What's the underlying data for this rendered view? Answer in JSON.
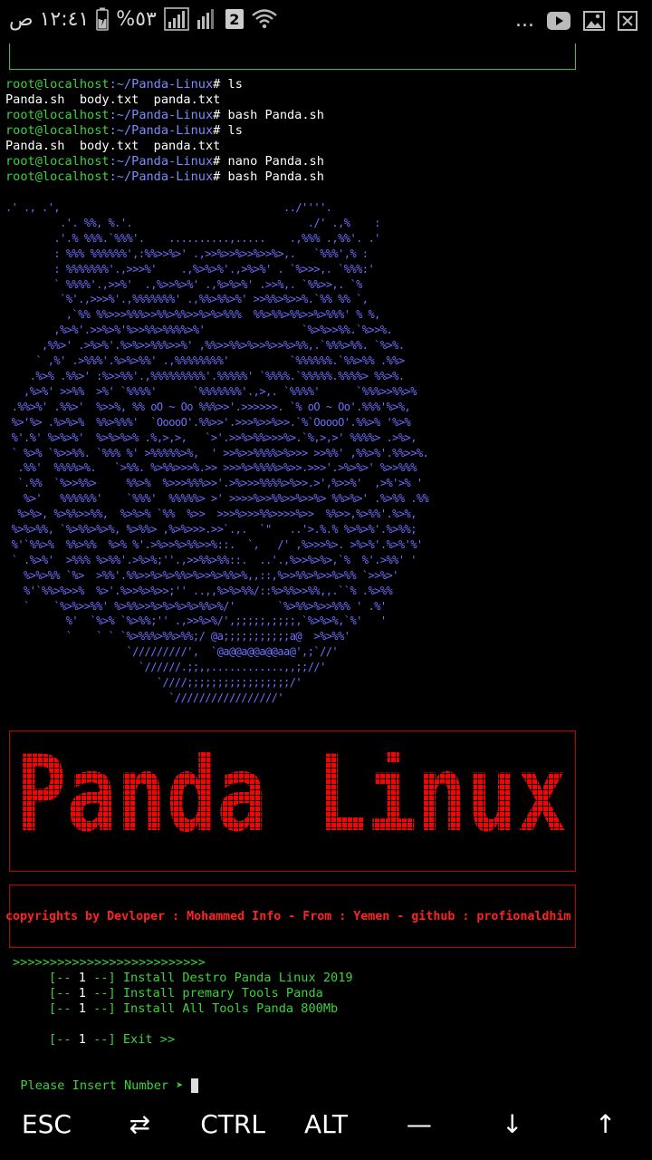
{
  "status_bar": {
    "time": "١٢:٤١ ص",
    "battery": "%٥٣",
    "sim": "2",
    "more": "...",
    "icons": [
      "battery-icon",
      "signal-icon",
      "sim-icon",
      "wifi-icon",
      "youtube-icon",
      "gallery-icon",
      "close-box-icon"
    ]
  },
  "terminal": {
    "history": [
      {
        "user": "root@localhost",
        "path": ":~/Panda-Linux",
        "prompt": "#",
        "cmd": " ls"
      },
      {
        "output": "Panda.sh  body.txt  panda.txt"
      },
      {
        "user": "root@localhost",
        "path": ":~/Panda-Linux",
        "prompt": "#",
        "cmd": " bash Panda.sh"
      },
      {
        "user": "root@localhost",
        "path": ":~/Panda-Linux",
        "prompt": "#",
        "cmd": " ls"
      },
      {
        "output": "Panda.sh  body.txt  panda.txt"
      },
      {
        "user": "root@localhost",
        "path": ":~/Panda-Linux",
        "prompt": "#",
        "cmd": " nano Panda.sh"
      },
      {
        "user": "root@localhost",
        "path": ":~/Panda-Linux",
        "prompt": "#",
        "cmd": " bash Panda.sh"
      }
    ],
    "ascii_art": [
      ".' ., .',                                     ../''''.",
      "         .'. %%, %.'.                             ./' .,%    :",
      "        .'.% %%%.`%%%'.    ..........,.....    .,%%% .,%%'. .'",
      "        : %%% %%%%%%',:%%>>%>' .,>>%>>%>>%>>%>,.   `%%%',% :",
      "        : %%%%%%%'.,>>>%'    .,%>%>%'.,>%>%' . `%>>>,. `%%%:'",
      "        ` %%%%'.,>>%'  .,%>>%>%' .,%>%>%' .>>%,. `%%>>,. `%",
      "         `%'.,>>>%'.,%%%%%%%' .,%%>%%>%' >>%%>%>>%.`%% %% `,",
      "          ,`%% %%>>>%%%>>%%>%%>>%>%>%%%  %%>%%>%%>>%>%%%' % %,",
      "        ,%>%'.>>%>%'%>>%%>%%%%>%'                `%>%>>%%.`%>>%.",
      "      ,%%>' .>%>%'.%>%>>%%%>>%' ,%%>>%%>%>>%>>%>%%,.`%%%>%%. `%>%.",
      "     ` ,%' .>%%%'.%>%>%%' .,%%%%%%%%'          `%%%%%%.`%%>%% .%%>",
      "    .%>% .%%>' :%>>%%'.,%%%%%%%%%'.%%%%%' `%%%%.`%%%%%.%%%%> %%>%.",
      "   ,%>%' >>%%  >%' `%%%%'      `%%%%%%%'.,>,. `%%%%'      `%%%>>%%>%",
      " .%%>%' .%%>'  %>>%, %% oO ~ Oo %%%>>'.>>>>>>. `% oO ~ Oo'.%%%'%>%,",
      " %>'%> .%>%>%  %%>%%%'  `OoooO'.%%>>'.>>>%>>%>>.`%`OoooO'.%%>% '%>%",
      " %'.%' %>%>%'  %>%>%>% .%,>,>,   `>'.>>%>%%>>>%>.`%,>,>' %%%%> .>%>,",
      " ` %>% `%>>%%. `%%% %' >%%%%%>%,  ' >>%>>%%%%>%>>> >>%%' ,%%>%'.%%>>%.",
      "  .%%'  %%%%>%.   `>%%. %>%%>>>%.>> >>>%>%%%%>%>>.>>>'.>%>%>' %>>%%%",
      "  `.%%  `%>>%%>     %%>%  %>>>%%%>>'.>%>>>%%%%>%>>.>',%>>%'  ,>%'>% '",
      "   %>'   %%%%%%'    `%%%'  %%%%%> >' >>>>%>>%%>>%>>%> %%>%>' .%>%% .%%",
      "  %>%>, %>%%>>%%,  %>%>% `%%  %>>  >>>%>>>%%>>>>%>>  %%>>,%>%%'.%>%,",
      " %>%>%%, `%>%%>%>%, %>%%> ,%>%>>>.>>`.,.  `\"   ..'>.%.% %>%>%'.%>%%;",
      " %'`%%>%  %%>%%  %>% %'.>%>>%>%%>>%::.  `,   /' ,%>>>%>. >%>%'.%>%'%'",
      " ` .%>%'  >%%% %>%%'.>%>%;''.,>>%%>%%::.  ..'.,%>>%>%>,`%  %'.>%%' '",
      "   %>%>%% `%>  >%%'.%%>>%>%>%%>%>>%>%%>%,,::,%>>%%>%>>%>%% `>>%>'",
      "   %'`%%>%>>%  %>'.%>>%>%>>;'' ..,,%>%>%%/::%>%%>>%%,,.``% .%>%%",
      "   `    `%>%>>%%' %>%%>>%>%>%>%>%%>%/'       `%>%%>%>>%%% ' .%'",
      "          %'  `%>% `%>%%;'' .,>>%>%/',;;;;;,;;;;,`%>%>%,`%'   '",
      "          `    ` ` `%>%%%>%%>%%;/ @a;;;;;;;;;;;a@  >%>%%'",
      "                    `/////////',  `@a@@a@@a@@aa@',;`//'",
      "                      `//////.;;,,............,,;;//'",
      "                         `////;;;;;;;;;;;;;;;;;/'",
      "                           `/////////////////'"
    ],
    "banner_title": "Panda Linux",
    "copyright": "copyrights by Devloper : Mohammed Info - From : Yemen - github : profionaldhim",
    "menu_header": ">>>>>>>>>>>>>>>>>>>>>>>>>>",
    "menu": [
      {
        "num": "1",
        "label": "Install Destro Panda Linux 2019"
      },
      {
        "num": "1",
        "label": "Install premary Tools Panda"
      },
      {
        "num": "1",
        "label": "Install All Tools Panda 800Mb"
      }
    ],
    "exit": {
      "num": "1",
      "label": "Exit >>"
    },
    "menu_bracket_open": "[-- ",
    "menu_bracket_close": " --]",
    "input_prompt": "Please Insert Number ➤ "
  },
  "extra_keys": [
    "ESC",
    "⇄",
    "CTRL",
    "ALT",
    "—",
    "↓",
    "↑"
  ],
  "colors": {
    "user": "#3cd23c",
    "path": "#7b8cff",
    "banner": "#ff0000",
    "menu": "#3cd23c",
    "background": "#000000"
  }
}
